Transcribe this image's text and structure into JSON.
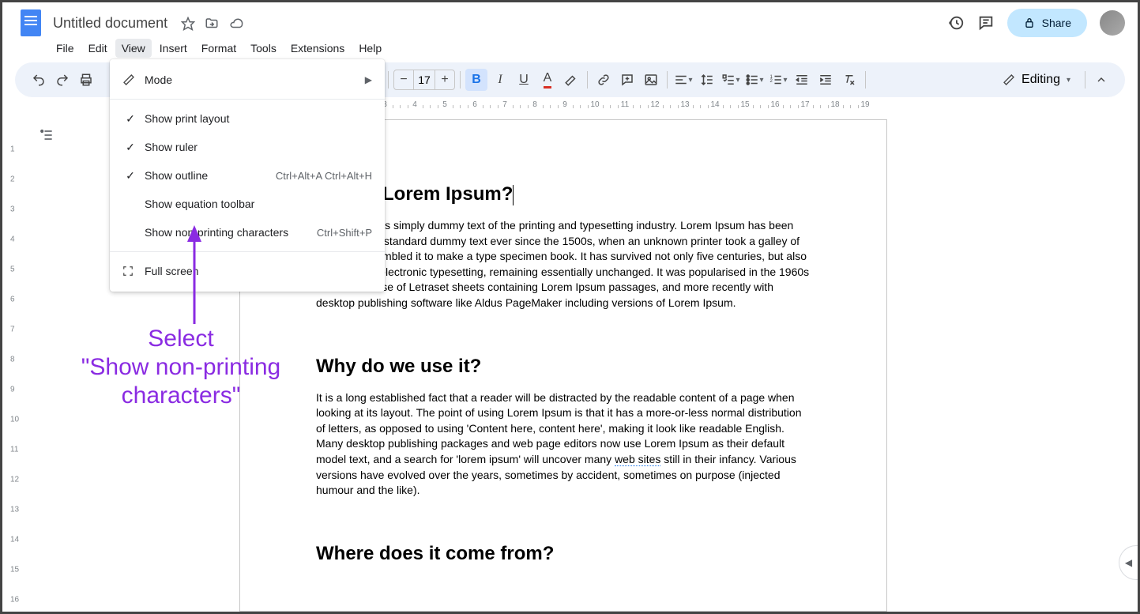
{
  "doc": {
    "title": "Untitled document"
  },
  "menubar": [
    "File",
    "Edit",
    "View",
    "Insert",
    "Format",
    "Tools",
    "Extensions",
    "Help"
  ],
  "share_label": "Share",
  "toolbar": {
    "font_size": "17",
    "editing_label": "Editing"
  },
  "dropdown": {
    "items": [
      {
        "label": "Mode",
        "type": "submenu"
      },
      {
        "type": "sep"
      },
      {
        "label": "Show print layout",
        "checked": true
      },
      {
        "label": "Show ruler",
        "checked": true
      },
      {
        "label": "Show outline",
        "checked": true,
        "shortcut": "Ctrl+Alt+A Ctrl+Alt+H"
      },
      {
        "label": "Show equation toolbar",
        "checked": false
      },
      {
        "label": "Show non-printing characters",
        "checked": false,
        "shortcut": "Ctrl+Shift+P"
      },
      {
        "type": "sep"
      },
      {
        "label": "Full screen",
        "icon": "fullscreen"
      }
    ]
  },
  "ruler_h": [
    3,
    4,
    5,
    6,
    7,
    8,
    9,
    10,
    11,
    12,
    13,
    14,
    15,
    16,
    17,
    18,
    19
  ],
  "ruler_v": [
    1,
    2,
    3,
    4,
    5,
    6,
    7,
    8,
    9,
    10,
    11,
    12,
    13,
    14,
    15,
    16
  ],
  "content": {
    "h1": "Lorem Ipsum?",
    "p1": "is simply dummy text of the printing and typesetting industry. Lorem Ipsum has been the industry's standard dummy text ever since the 1500s, when an unknown printer took a galley of type and scrambled it to make a type specimen book. It has survived not only five centuries, but also the leap into electronic typesetting, remaining essentially unchanged. It was popularised in the 1960s with the release of Letraset sheets containing Lorem Ipsum passages, and more recently with desktop publishing software like Aldus PageMaker including versions of Lorem Ipsum.",
    "h2": "Why do we use it?",
    "p2a": "It is a long established fact that a reader will be distracted by the readable content of a page when looking at its layout. The point of using Lorem Ipsum is that it has a more-or-less normal distribution of letters, as opposed to using 'Content here, content here', making it look like readable English. Many desktop publishing packages and web page editors now use Lorem Ipsum as their default model text, and a search for 'lorem ipsum' will uncover many ",
    "p2_link": "web sites",
    "p2b": " still in their infancy. Various versions have evolved over the years, sometimes by accident, sometimes on purpose (injected humour and the like).",
    "h3": "Where does it come from?"
  },
  "annotation": {
    "line1": "Select",
    "line2": "\"Show non-printing",
    "line3": "characters\""
  }
}
